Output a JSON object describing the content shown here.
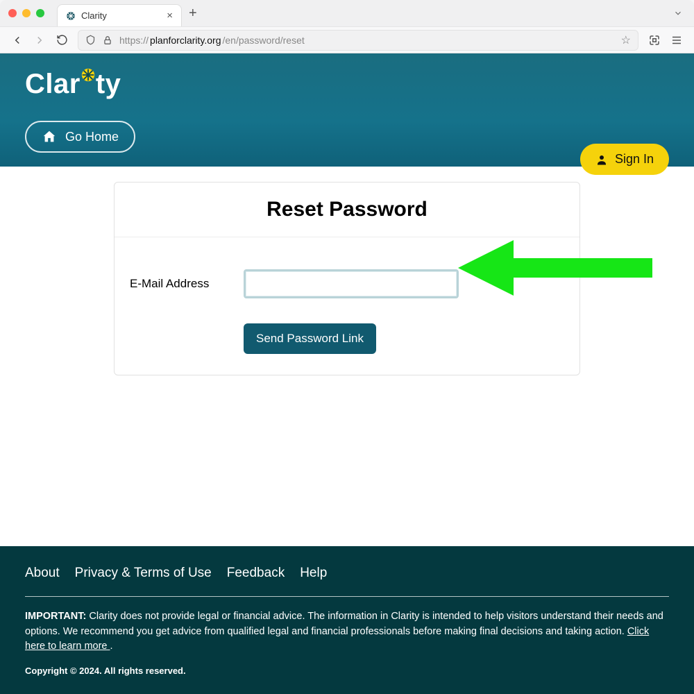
{
  "browser": {
    "tab_title": "Clarity",
    "url_scheme": "https://",
    "url_host": "planforclarity.org",
    "url_path": "/en/password/reset"
  },
  "header": {
    "brand": "Clarity",
    "go_home": "Go Home",
    "sign_in": "Sign In"
  },
  "card": {
    "title": "Reset Password",
    "email_label": "E-Mail Address",
    "email_value": "",
    "send_button": "Send Password Link"
  },
  "footer": {
    "links": [
      "About",
      "Privacy & Terms of Use",
      "Feedback",
      "Help"
    ],
    "important_label": "IMPORTANT:",
    "important_text": " Clarity does not provide legal or financial advice. The information in Clarity is intended to help visitors understand their needs and options. We recommend you get advice from qualified legal and financial professionals before making final decisions and taking action. ",
    "learn_more": "Click here to learn more ",
    "copyright": "Copyright © 2024. All rights reserved."
  },
  "annotation": {
    "color": "#16e616"
  }
}
